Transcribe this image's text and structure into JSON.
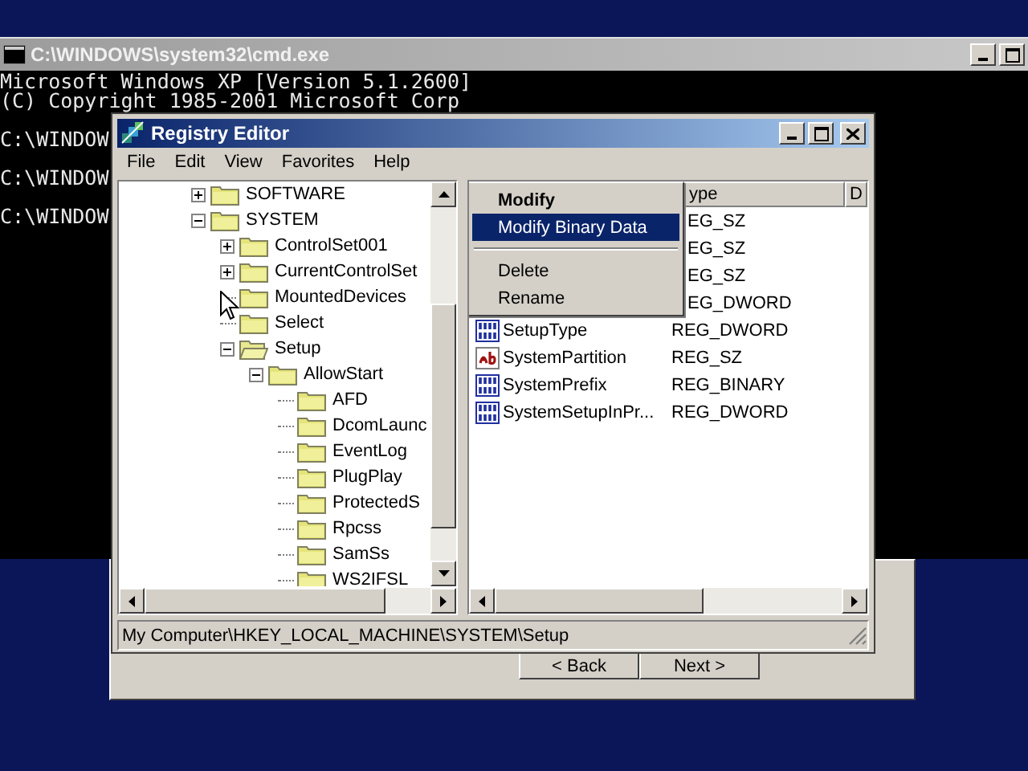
{
  "console_window": {
    "title": "C:\\WINDOWS\\system32\\cmd.exe",
    "lines": [
      {
        "text": "Microsoft Windows XP [Version 5.1.2600]"
      },
      {
        "text": "(C) Copyright 1985-2001 Microsoft Corp"
      },
      {
        "text": "C:\\WINDOW"
      },
      {
        "text": "C:\\WINDOW"
      },
      {
        "text": "C:\\WINDOW"
      }
    ]
  },
  "setup_dialog": {
    "buttons": [
      {
        "label": "< Back"
      },
      {
        "label": "Next >"
      }
    ]
  },
  "registry_editor": {
    "title": "Registry Editor",
    "menu": [
      "File",
      "Edit",
      "View",
      "Favorites",
      "Help"
    ],
    "tree": [
      {
        "label": "SOFTWARE",
        "kind": "branch",
        "expanded": false,
        "selected": false
      },
      {
        "label": "SYSTEM",
        "kind": "branch",
        "expanded": true,
        "selected": false,
        "children": [
          {
            "label": "ControlSet001",
            "kind": "branch",
            "expanded": false,
            "selected": false
          },
          {
            "label": "CurrentControlSet",
            "kind": "branch",
            "expanded": false,
            "selected": false
          },
          {
            "label": "MountedDevices",
            "kind": "leaf",
            "selected": false
          },
          {
            "label": "Select",
            "kind": "leaf",
            "selected": false
          },
          {
            "label": "Setup",
            "kind": "branch",
            "expanded": true,
            "selected": true,
            "children": [
              {
                "label": "AllowStart",
                "kind": "branch",
                "expanded": true,
                "selected": false,
                "children": [
                  {
                    "label": "AFD",
                    "kind": "leaf",
                    "selected": false
                  },
                  {
                    "label": "DcomLaunc",
                    "kind": "leaf",
                    "selected": false
                  },
                  {
                    "label": "EventLog",
                    "kind": "leaf",
                    "selected": false
                  },
                  {
                    "label": "PlugPlay",
                    "kind": "leaf",
                    "selected": false
                  },
                  {
                    "label": "ProtectedS",
                    "kind": "leaf",
                    "selected": false
                  },
                  {
                    "label": "Rpcss",
                    "kind": "leaf",
                    "selected": false
                  },
                  {
                    "label": "SamSs",
                    "kind": "leaf",
                    "selected": false
                  },
                  {
                    "label": "WS2IFSL",
                    "kind": "leaf",
                    "selected": false
                  }
                ]
              }
            ]
          }
        ]
      }
    ],
    "columns": [
      {
        "label": "ype"
      },
      {
        "label": "D"
      }
    ],
    "values": [
      {
        "type": "EG_SZ"
      },
      {
        "type": "EG_SZ"
      },
      {
        "type": "EG_SZ"
      },
      {
        "type": "EG_DWORD"
      },
      {
        "name": "SetupType",
        "type": "REG_DWORD",
        "kind": "binary"
      },
      {
        "name": "SystemPartition",
        "type": "REG_SZ",
        "kind": "string"
      },
      {
        "name": "SystemPrefix",
        "type": "REG_BINARY",
        "kind": "binary"
      },
      {
        "name": "SystemSetupInPr...",
        "type": "REG_DWORD",
        "kind": "binary"
      }
    ],
    "status_bar": "My Computer\\HKEY_LOCAL_MACHINE\\SYSTEM\\Setup",
    "context_menu": [
      {
        "kind": "item",
        "label": "Modify",
        "default": true,
        "selected": false
      },
      {
        "kind": "item",
        "label": "Modify Binary Data",
        "default": false,
        "selected": true
      },
      {
        "kind": "separator"
      },
      {
        "kind": "item",
        "label": "Delete",
        "default": false,
        "selected": false
      },
      {
        "kind": "item",
        "label": "Rename",
        "default": false,
        "selected": false
      }
    ]
  }
}
